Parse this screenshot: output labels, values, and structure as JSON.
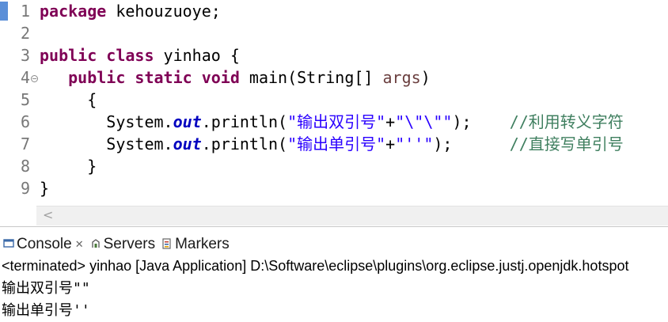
{
  "editor": {
    "lines": [
      {
        "num": "1",
        "tokens": [
          {
            "c": "kw",
            "t": "package"
          },
          {
            "c": "",
            "t": " kehouzuoye;"
          }
        ]
      },
      {
        "num": "2",
        "tokens": []
      },
      {
        "num": "3",
        "tokens": [
          {
            "c": "kw",
            "t": "public"
          },
          {
            "c": "",
            "t": " "
          },
          {
            "c": "kw",
            "t": "class"
          },
          {
            "c": "",
            "t": " yinhao {"
          }
        ]
      },
      {
        "num": "4",
        "fold": true,
        "tokens": [
          {
            "c": "",
            "t": "   "
          },
          {
            "c": "kw",
            "t": "public"
          },
          {
            "c": "",
            "t": " "
          },
          {
            "c": "kw",
            "t": "static"
          },
          {
            "c": "",
            "t": " "
          },
          {
            "c": "kw",
            "t": "void"
          },
          {
            "c": "",
            "t": " main(String[] "
          },
          {
            "c": "param",
            "t": "args"
          },
          {
            "c": "",
            "t": ")"
          }
        ]
      },
      {
        "num": "5",
        "tokens": [
          {
            "c": "",
            "t": "     {"
          }
        ]
      },
      {
        "num": "6",
        "tokens": [
          {
            "c": "",
            "t": "       System."
          },
          {
            "c": "field",
            "t": "out"
          },
          {
            "c": "",
            "t": ".println("
          },
          {
            "c": "str",
            "t": "\"输出双引号\""
          },
          {
            "c": "",
            "t": "+"
          },
          {
            "c": "str",
            "t": "\"\\\"\\\"\""
          },
          {
            "c": "",
            "t": ");    "
          },
          {
            "c": "cmt",
            "t": "//利用转义字符"
          }
        ]
      },
      {
        "num": "7",
        "tokens": [
          {
            "c": "",
            "t": "       System."
          },
          {
            "c": "field",
            "t": "out"
          },
          {
            "c": "",
            "t": ".println("
          },
          {
            "c": "str",
            "t": "\"输出单引号\""
          },
          {
            "c": "",
            "t": "+"
          },
          {
            "c": "str",
            "t": "\"''\""
          },
          {
            "c": "",
            "t": ");      "
          },
          {
            "c": "cmt",
            "t": "//直接写单引号"
          }
        ]
      },
      {
        "num": "8",
        "tokens": [
          {
            "c": "",
            "t": "     }"
          }
        ]
      },
      {
        "num": "9",
        "tokens": [
          {
            "c": "",
            "t": "}"
          }
        ]
      }
    ]
  },
  "scrollbar": {
    "left_arrow": "<"
  },
  "panel": {
    "tabs": [
      {
        "label": "Console",
        "icon": "console-icon",
        "close": "✕",
        "active": true
      },
      {
        "label": "Servers",
        "icon": "servers-icon"
      },
      {
        "label": "Markers",
        "icon": "markers-icon"
      }
    ],
    "status": "<terminated> yinhao [Java Application] D:\\Software\\eclipse\\plugins\\org.eclipse.justj.openjdk.hotspot",
    "output": [
      "输出双引号\"\"",
      "输出单引号''"
    ]
  }
}
